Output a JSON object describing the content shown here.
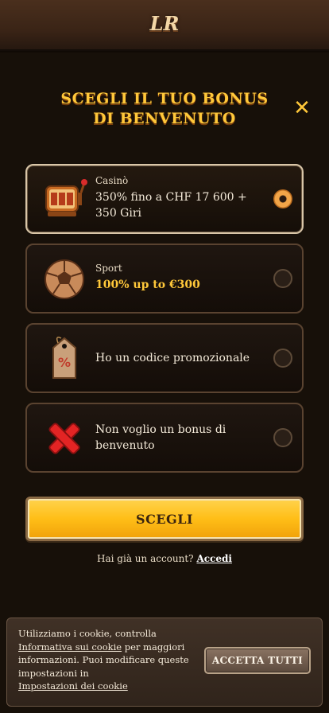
{
  "header": {
    "logo_text": "LR"
  },
  "modal": {
    "title_line1": "SCEGLI IL TUO BONUS",
    "title_line2": "DI BENVENUTO",
    "close_symbol": "✕"
  },
  "options": [
    {
      "label": "Casinò",
      "value": "350% fino a CHF 17 600 + 350 Giri",
      "selected": true,
      "icon": "slot-machine-icon"
    },
    {
      "label": "Sport",
      "value": "100% up to €300",
      "selected": false,
      "icon": "football-icon"
    },
    {
      "label": "",
      "value": "Ho un codice promozionale",
      "selected": false,
      "icon": "price-tag-icon"
    },
    {
      "label": "",
      "value": "Non voglio un bonus di benvenuto",
      "selected": false,
      "icon": "red-cross-icon"
    }
  ],
  "cta": {
    "label": "SCEGLI"
  },
  "login": {
    "prompt": "Hai già un account?",
    "link": "Accedi"
  },
  "cookie": {
    "text1": "Utilizziamo i cookie, controlla",
    "link1": "Informativa sui cookie",
    "text2": " per maggiori informazioni. Puoi modificare queste impostazioni in",
    "link2": "Impostazioni dei cookie",
    "button": "ACCETTA TUTTI"
  },
  "colors": {
    "accent": "#ffc83a",
    "background": "#171009",
    "cta": "#ffbe17"
  }
}
